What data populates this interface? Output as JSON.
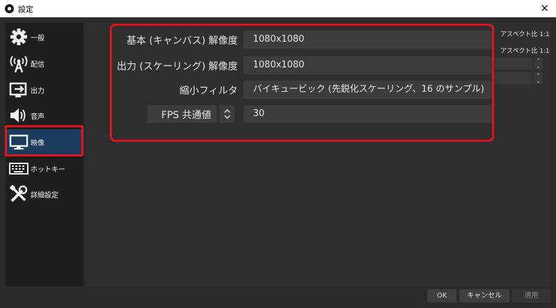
{
  "window": {
    "title": "設定"
  },
  "sidebar": {
    "items": [
      {
        "label": "一般",
        "icon": "gear-icon"
      },
      {
        "label": "配信",
        "icon": "broadcast-icon"
      },
      {
        "label": "出力",
        "icon": "output-icon"
      },
      {
        "label": "音声",
        "icon": "speaker-icon"
      },
      {
        "label": "映像",
        "icon": "monitor-icon",
        "selected": true
      },
      {
        "label": "ホットキー",
        "icon": "keyboard-icon"
      },
      {
        "label": "詳細設定",
        "icon": "tools-icon"
      }
    ]
  },
  "video": {
    "base_resolution": {
      "label": "基本 (キャンバス) 解像度",
      "value": "1080x1080"
    },
    "output_resolution": {
      "label": "出力 (スケーリング) 解像度",
      "value": "1080x1080"
    },
    "downscale_filter": {
      "label": "縮小フィルタ",
      "value": "バイキュービック (先鋭化スケーリング、16 のサンプル)"
    },
    "fps": {
      "label": "FPS 共通値",
      "value": "30"
    }
  },
  "right_panel": {
    "aspect_1": "アスペクト比 1:1",
    "aspect_2": "アスペクト比 1:1"
  },
  "buttons": {
    "ok": "OK",
    "cancel": "キャンセル",
    "apply": "適用"
  },
  "colors": {
    "highlight": "#e0141c",
    "selected": "#1d3b5c"
  }
}
